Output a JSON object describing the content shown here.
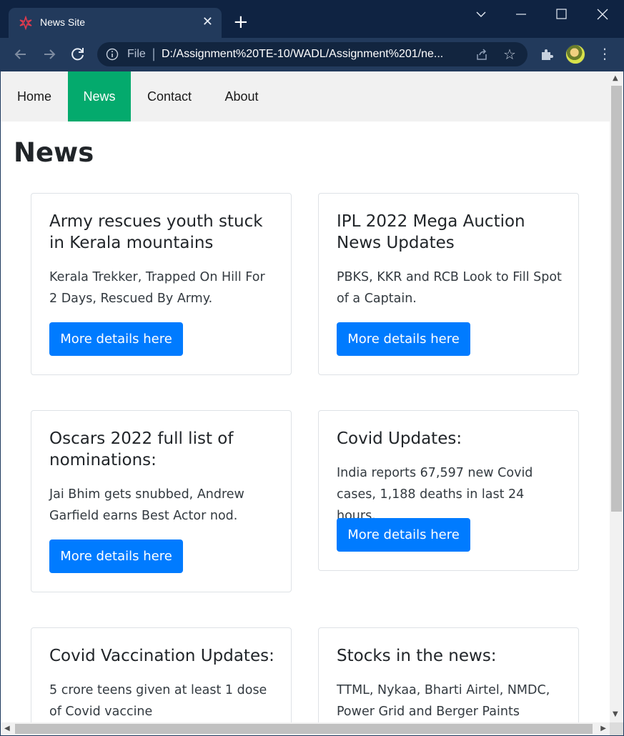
{
  "browser": {
    "tab_title": "News Site",
    "tab_close": "✕",
    "new_tab": "+",
    "address_scheme": "File",
    "address_separator": "|",
    "address_url": "D:/Assignment%20TE-10/WADL/Assignment%201/ne...",
    "favicon_color": "#e03a4e",
    "icons": [
      "back-arrow-icon",
      "forward-arrow-icon",
      "reload-icon",
      "info-icon",
      "share-icon",
      "star-icon",
      "extensions-icon",
      "profile-avatar",
      "menu-kebab-icon"
    ]
  },
  "nav": {
    "home": "Home",
    "news": "News",
    "contact": "Contact",
    "about": "About",
    "active_color": "#04aa6d"
  },
  "page": {
    "title": "News"
  },
  "cards": [
    {
      "title": "Army rescues youth stuck in Kerala mountains",
      "text": "Kerala Trekker, Trapped On Hill For 2 Days, Rescued By Army.",
      "button": "More details here"
    },
    {
      "title": "IPL 2022 Mega Auction News Updates",
      "text": "PBKS, KKR and RCB Look to Fill Spot of a Captain.",
      "button": "More details here"
    },
    {
      "title": "Oscars 2022 full list of nominations:",
      "text": "Jai Bhim gets snubbed, Andrew Garfield earns Best Actor nod.",
      "button": "More details here"
    },
    {
      "title": "Covid Updates:",
      "text": "India reports 67,597 new Covid cases, 1,188 deaths in last 24 hours.",
      "button": "More details here"
    },
    {
      "title": "Covid Vaccination Updates:",
      "text": "5 crore teens given at least 1 dose of Covid vaccine",
      "button": ""
    },
    {
      "title": "Stocks in the news:",
      "text": "TTML, Nykaa, Bharti Airtel, NMDC, Power Grid and Berger Paints",
      "button": ""
    }
  ],
  "colors": {
    "button": "#007bff",
    "chrome_dark": "#0f2342",
    "chrome_tab": "#223a5c"
  }
}
